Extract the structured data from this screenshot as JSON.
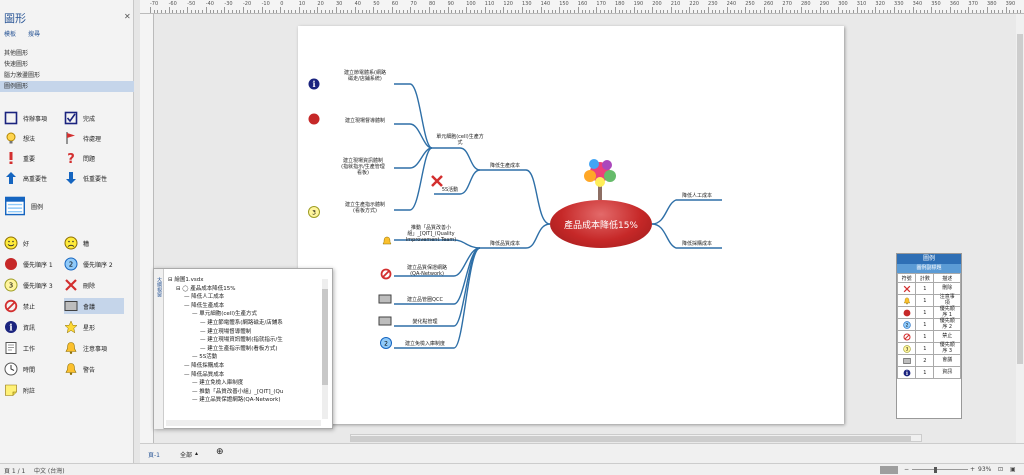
{
  "shapes_panel": {
    "title": "圖形",
    "tabs": [
      "模板",
      "搜尋"
    ],
    "stencils": [
      "其他圖形",
      "快速圖形",
      "腦力激盪圖形",
      "圖例圖形"
    ],
    "shapes": [
      {
        "label": "待辦事項",
        "icon": "empty-box-icon"
      },
      {
        "label": "完成",
        "icon": "check-box-icon"
      },
      {
        "label": "想法",
        "icon": "lightbulb-icon"
      },
      {
        "label": "待處理",
        "icon": "red-flag-icon"
      },
      {
        "label": "重要",
        "icon": "exclamation-icon"
      },
      {
        "label": "問題",
        "icon": "question-icon"
      },
      {
        "label": "高重要性",
        "icon": "up-arrow-icon"
      },
      {
        "label": "低重要性",
        "icon": "down-arrow-icon"
      },
      {
        "label": "圖例",
        "icon": "legend-icon"
      },
      {
        "label": "好",
        "icon": "smile-icon"
      },
      {
        "label": "糟",
        "icon": "frown-icon"
      },
      {
        "label": "優先順序 1",
        "icon": "priority-1-icon"
      },
      {
        "label": "優先順序 2",
        "icon": "priority-2-icon"
      },
      {
        "label": "優先順序 3",
        "icon": "priority-3-icon"
      },
      {
        "label": "刪除",
        "icon": "red-x-icon"
      },
      {
        "label": "禁止",
        "icon": "prohibited-icon"
      },
      {
        "label": "會議",
        "icon": "meeting-icon"
      },
      {
        "label": "資訊",
        "icon": "info-icon"
      },
      {
        "label": "星形",
        "icon": "star-icon"
      },
      {
        "label": "工作",
        "icon": "work-icon"
      },
      {
        "label": "注意事項",
        "icon": "bell-icon"
      },
      {
        "label": "時間",
        "icon": "clock-icon"
      },
      {
        "label": "警告",
        "icon": "warning-bell-icon"
      },
      {
        "label": "附註",
        "icon": "note-icon"
      }
    ]
  },
  "ruler": {
    "top_numbers": [
      "-70",
      "-60",
      "-50",
      "-40",
      "-30",
      "-20",
      "-10",
      "0",
      "10",
      "20",
      "30",
      "40",
      "50",
      "60",
      "70",
      "80",
      "90",
      "100",
      "110",
      "120",
      "130",
      "140",
      "150",
      "160",
      "170",
      "180",
      "190",
      "200",
      "210",
      "220",
      "230",
      "240",
      "250",
      "260",
      "270",
      "280",
      "290",
      "300",
      "310",
      "320",
      "330",
      "340",
      "350",
      "360",
      "370",
      "380",
      "390"
    ]
  },
  "mindmap": {
    "central": "產品成本降低15%",
    "branches": {
      "reduce_production_cost": "降低生產成本",
      "reduce_quality_cost": "降低品質成本",
      "reduce_labor_cost": "降低人工成本",
      "reduce_purchase_cost": "降低採購成本",
      "cell_production": "單元細胞(cell)生產方\n式",
      "five_s": "5S活動"
    },
    "leaves": [
      {
        "text": "建立節電體系(網路\n磁走/店鋪系統)"
      },
      {
        "text": "建立現場督導體制"
      },
      {
        "text": "建立現場資訊體制\n(指就指示/生產管理\n看板)"
      },
      {
        "text": "建立生產指示體制\n(看板方式)"
      },
      {
        "text": "推動「品質改善小\n組」_[QIT]_(Quality\nImprovement Team)"
      },
      {
        "text": "建立品質保證網路\n(QA-Network)"
      },
      {
        "text": "建立品管圈QCC"
      },
      {
        "text": "變化點管理"
      },
      {
        "text": "建立免檢入庫制度"
      }
    ]
  },
  "legend": {
    "title": "圖例",
    "subtitle": "圖例副標題",
    "headers": [
      "符號",
      "計數",
      "描述"
    ],
    "rows": [
      {
        "icon": "red-x-icon",
        "count": "1",
        "desc": "刪除"
      },
      {
        "icon": "bell-icon",
        "count": "1",
        "desc": "注意事\n項"
      },
      {
        "icon": "priority-1-icon",
        "count": "1",
        "desc": "優先順\n序 1"
      },
      {
        "icon": "priority-2-icon",
        "count": "1",
        "desc": "優先順\n序 2"
      },
      {
        "icon": "prohibited-icon",
        "count": "1",
        "desc": "禁止"
      },
      {
        "icon": "priority-3-icon",
        "count": "1",
        "desc": "優先順\n序 3"
      },
      {
        "icon": "meeting-icon",
        "count": "2",
        "desc": "會議"
      },
      {
        "icon": "info-icon",
        "count": "1",
        "desc": "資訊"
      }
    ]
  },
  "outline": {
    "side_label": "大綱視窗",
    "rows": [
      "繪圖1.vsdx",
      "產品成本降低15%",
      "降低人工成本",
      "降低生產成本",
      "單元細胞(cell)生產方式",
      "建立節電體系(網路磁走/店鋪系",
      "建立現場督導體制",
      "建立現場資訊體制(指就指示/生",
      "建立生產指示體制(看板方式)",
      "5S活動",
      "降低採購成本",
      "降低品質成本",
      "建立免檢入庫制度",
      "推動「品質改善小組」_[QIT]_(Qu",
      "建立品質保證網路(QA-Network)"
    ]
  },
  "page_tabs": {
    "page1": "頁-1",
    "all": "全部",
    "add": "⊕"
  },
  "status": {
    "page": "頁 1 / 1",
    "language": "中文 (台灣)",
    "zoom": "93%"
  }
}
